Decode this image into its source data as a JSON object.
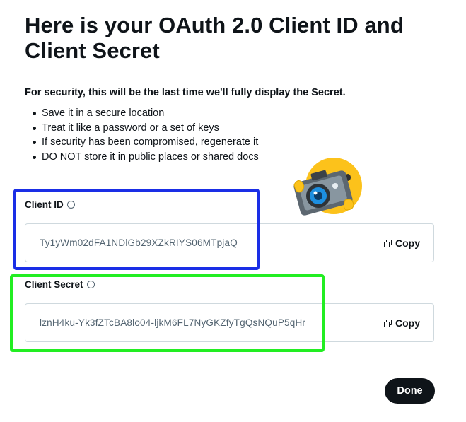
{
  "title": "Here is your OAuth 2.0 Client ID and Client Secret",
  "security_note": "For security, this will be the last time we'll fully display the Secret.",
  "bullets": [
    "Save it in a secure location",
    "Treat it like a password or a set of keys",
    "If security has been compromised, regenerate it",
    "DO NOT store it in public places or shared docs"
  ],
  "client_id": {
    "label": "Client ID",
    "value": "Ty1yWm02dFA1NDlGb29XZkRIYS06MTpjaQ",
    "copy_label": "Copy"
  },
  "client_secret": {
    "label": "Client Secret",
    "value": "lznH4ku-Yk3fZTcBA8lo04-ljkM6FL7NyGKZfyTgQsNQuP5qHr",
    "copy_label": "Copy"
  },
  "done_label": "Done",
  "colors": {
    "highlight_client_id": "#1a2ee6",
    "highlight_client_secret": "#22ee22",
    "button_bg": "#0f1419"
  },
  "icons": [
    "info-icon",
    "copy-icon",
    "camera-emoji"
  ]
}
